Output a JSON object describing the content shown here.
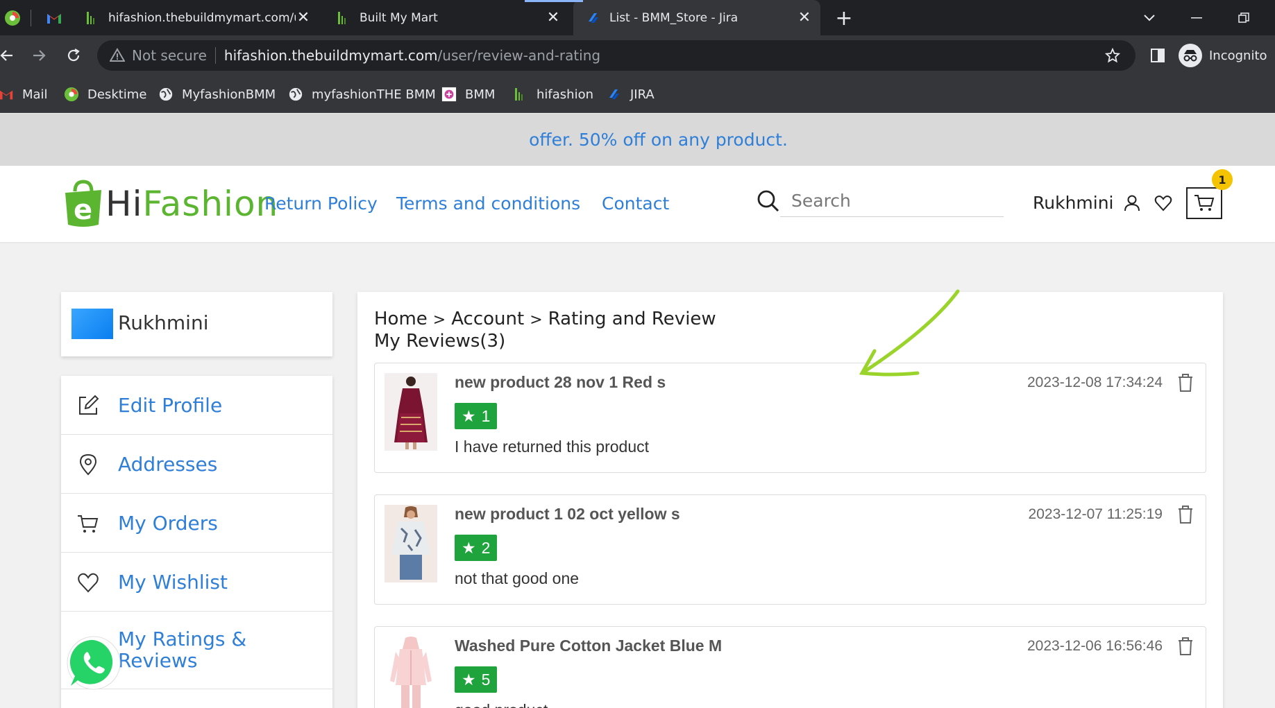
{
  "browser": {
    "tabs": [
      {
        "title": "hifashion.thebuildmymart.com/u",
        "active": false
      },
      {
        "title": "Built My Mart",
        "active": false
      },
      {
        "title": "List - BMM_Store - Jira",
        "active": true
      }
    ],
    "address": {
      "security_label": "Not secure",
      "host": "hifashion.thebuildmymart.com",
      "path": "/user/review-and-rating"
    },
    "profile_label": "Incognito",
    "bookmarks": [
      {
        "label": "Mail",
        "icon": "gmail-icon"
      },
      {
        "label": "Desktime",
        "icon": "desktime-icon"
      },
      {
        "label": "MyfashionBMM",
        "icon": "globe-icon"
      },
      {
        "label": "myfashionTHE BMM",
        "icon": "globe-icon"
      },
      {
        "label": "BMM",
        "icon": "bmm-icon"
      },
      {
        "label": "hifashion",
        "icon": "hifashion-icon"
      },
      {
        "label": "JIRA",
        "icon": "jira-icon"
      }
    ]
  },
  "site": {
    "offer_text": "offer. 50% off on any product.",
    "logo": {
      "part1": "Hi",
      "part2": "Fashion"
    },
    "nav": [
      "Return Policy",
      "Terms and conditions",
      "Contact"
    ],
    "search_placeholder": "Search",
    "username": "Rukhmini",
    "cart_count": "1"
  },
  "sidebar": {
    "user_name": "Rukhmini",
    "menu": [
      {
        "label": "Edit Profile",
        "icon": "edit-icon"
      },
      {
        "label": "Addresses",
        "icon": "location-pin-icon"
      },
      {
        "label": "My Orders",
        "icon": "cart-icon"
      },
      {
        "label": "My Wishlist",
        "icon": "heart-icon"
      },
      {
        "label": "My Ratings & Reviews",
        "icon": "star-icon"
      }
    ]
  },
  "main": {
    "breadcrumb": [
      "Home",
      "Account",
      "Rating and Review"
    ],
    "count_label": "My Reviews(3)",
    "reviews": [
      {
        "product": "new product 28 nov 1 Red s",
        "rating": "1",
        "text": "I have returned this product",
        "date": "2023-12-08 17:34:24"
      },
      {
        "product": "new product 1 02 oct yellow s",
        "rating": "2",
        "text": "not that good one",
        "date": "2023-12-07 11:25:19"
      },
      {
        "product": "Washed Pure Cotton Jacket Blue M",
        "rating": "5",
        "text": "good product",
        "date": "2023-12-06 16:56:46"
      }
    ]
  },
  "colors": {
    "brand_green": "#5bb531",
    "link_blue": "#2f7fd8",
    "rating_green": "#1fa33c",
    "annotation_green": "#9ad42b"
  }
}
